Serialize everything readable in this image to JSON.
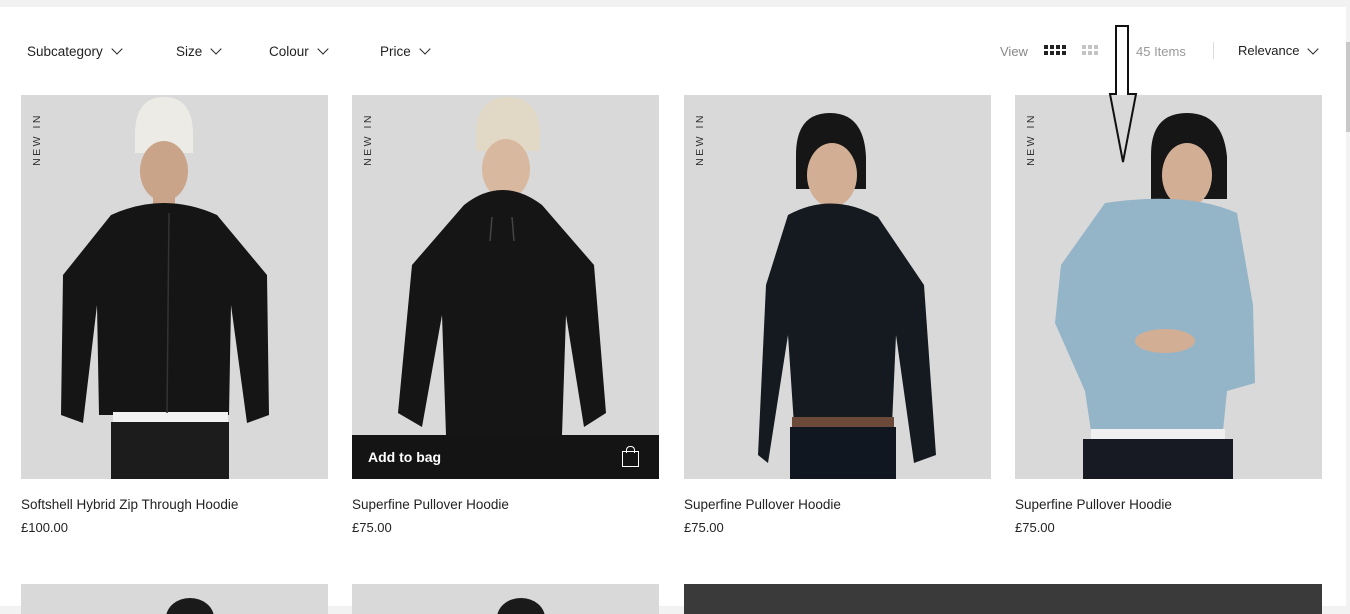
{
  "filters": {
    "subcategory": "Subcategory",
    "size": "Size",
    "colour": "Colour",
    "price": "Price"
  },
  "toolbar": {
    "view_label": "View",
    "items_count": "45 Items",
    "sort_label": "Relevance",
    "active_view": "4-column-grid"
  },
  "products": [
    {
      "badge": "NEW IN",
      "name": "Softshell Hybrid Zip Through Hoodie",
      "price": "£100.00",
      "colour": "black"
    },
    {
      "badge": "NEW IN",
      "name": "Superfine Pullover Hoodie",
      "price": "£75.00",
      "colour": "black",
      "add_to_bag": "Add to bag"
    },
    {
      "badge": "NEW IN",
      "name": "Superfine Pullover Hoodie",
      "price": "£75.00",
      "colour": "dark navy"
    },
    {
      "badge": "NEW IN",
      "name": "Superfine Pullover Hoodie",
      "price": "£75.00",
      "colour": "light blue"
    }
  ],
  "colors": {
    "image_bg": "#d9d9d9",
    "add_to_bag_bg": "#141414",
    "hoodie_black": "#151515",
    "hoodie_navy": "#141a20",
    "hoodie_blue": "#94b4c8"
  },
  "icons": [
    "chevron-down-icon",
    "grid-4-icon",
    "grid-3-icon",
    "bag-icon",
    "down-arrow-annotation"
  ]
}
